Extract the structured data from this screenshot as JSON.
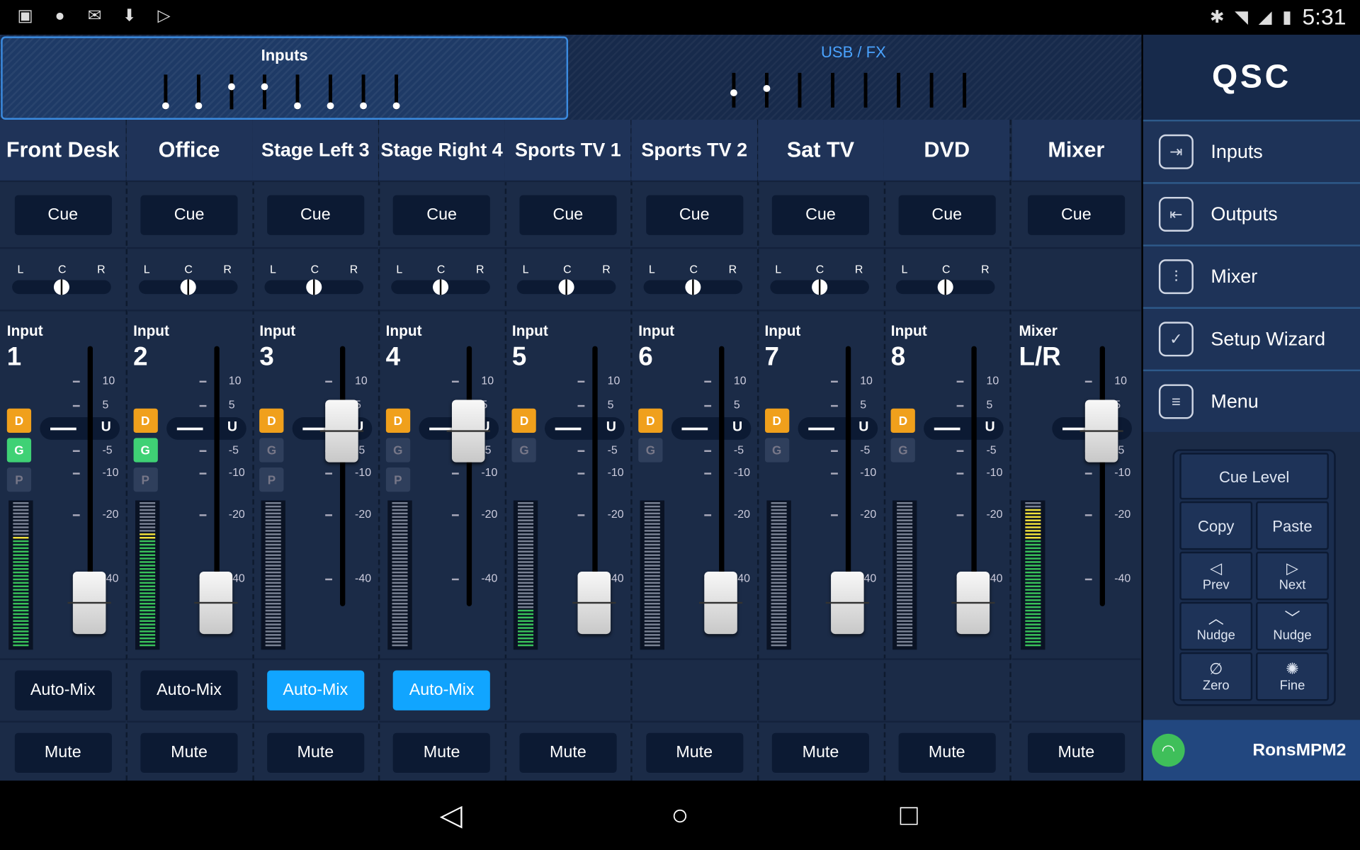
{
  "status_bar": {
    "left_icons": [
      "image-icon",
      "alert-icon",
      "mail-open-icon",
      "download-icon",
      "play-store-icon"
    ],
    "right_icons": [
      "bluetooth-icon",
      "wifi-icon",
      "signal-icon",
      "battery-charging-icon"
    ],
    "time": "5:31"
  },
  "overview": {
    "inputs_label": "Inputs",
    "usb_fx_label": "USB / FX",
    "input_levels": [
      0.95,
      0.95,
      0.3,
      0.3,
      0.95,
      0.95,
      0.95,
      0.95
    ],
    "usb_fx_levels": [
      0.55,
      0.4,
      null,
      null,
      null,
      null,
      null,
      null
    ]
  },
  "channels": [
    {
      "name": "Front Desk",
      "cue": "Cue",
      "pan": {
        "l": "L",
        "c": "C",
        "r": "R"
      },
      "src": "Input",
      "num": "1",
      "d": "D",
      "g": "G",
      "p": "P",
      "g_on": true,
      "p_on": false,
      "fader": 0.0,
      "meter_level": 0.75,
      "automix": "Auto-Mix",
      "automix_on": false,
      "mute": "Mute"
    },
    {
      "name": "Office",
      "cue": "Cue",
      "pan": {
        "l": "L",
        "c": "C",
        "r": "R"
      },
      "src": "Input",
      "num": "2",
      "d": "D",
      "g": "G",
      "p": "P",
      "g_on": true,
      "p_on": false,
      "fader": 0.0,
      "meter_level": 0.78,
      "automix": "Auto-Mix",
      "automix_on": false,
      "mute": "Mute"
    },
    {
      "name": "Stage Left 3",
      "cue": "Cue",
      "pan": {
        "l": "L",
        "c": "C",
        "r": "R"
      },
      "src": "Input",
      "num": "3",
      "d": "D",
      "g": "G",
      "p": "P",
      "g_on": false,
      "p_on": false,
      "fader": 0.66,
      "meter_level": 0,
      "automix": "Auto-Mix",
      "automix_on": true,
      "mute": "Mute"
    },
    {
      "name": "Stage Right 4",
      "cue": "Cue",
      "pan": {
        "l": "L",
        "c": "C",
        "r": "R"
      },
      "src": "Input",
      "num": "4",
      "d": "D",
      "g": "G",
      "p": "P",
      "g_on": false,
      "p_on": false,
      "fader": 0.66,
      "meter_level": 0,
      "automix": "Auto-Mix",
      "automix_on": true,
      "mute": "Mute"
    },
    {
      "name": "Sports TV 1",
      "cue": "Cue",
      "pan": {
        "l": "L",
        "c": "C",
        "r": "R"
      },
      "src": "Input",
      "num": "5",
      "d": "D",
      "g": "G",
      "p": null,
      "g_on": false,
      "p_on": false,
      "fader": 0.0,
      "meter_level": 0.25,
      "automix": null,
      "automix_on": false,
      "mute": "Mute"
    },
    {
      "name": "Sports TV 2",
      "cue": "Cue",
      "pan": {
        "l": "L",
        "c": "C",
        "r": "R"
      },
      "src": "Input",
      "num": "6",
      "d": "D",
      "g": "G",
      "p": null,
      "g_on": false,
      "p_on": false,
      "fader": 0.0,
      "meter_level": 0,
      "automix": null,
      "automix_on": false,
      "mute": "Mute"
    },
    {
      "name": "Sat TV",
      "cue": "Cue",
      "pan": {
        "l": "L",
        "c": "C",
        "r": "R"
      },
      "src": "Input",
      "num": "7",
      "d": "D",
      "g": "G",
      "p": null,
      "g_on": false,
      "p_on": false,
      "fader": 0.0,
      "meter_level": 0,
      "automix": null,
      "automix_on": false,
      "mute": "Mute"
    },
    {
      "name": "DVD",
      "cue": "Cue",
      "pan": {
        "l": "L",
        "c": "C",
        "r": "R"
      },
      "src": "Input",
      "num": "8",
      "d": "D",
      "g": "G",
      "p": null,
      "g_on": false,
      "p_on": false,
      "fader": 0.0,
      "meter_level": 0,
      "automix": null,
      "automix_on": false,
      "mute": "Mute"
    }
  ],
  "mixer_channel": {
    "name": "Mixer",
    "cue": "Cue",
    "src": "Mixer",
    "num": "L/R",
    "fader": 0.66,
    "meter_level": 0.95,
    "mute": "Mute"
  },
  "fader_scale": [
    "10",
    "5",
    "U",
    "-5",
    "-10",
    "-20",
    "-40"
  ],
  "sidebar": {
    "logo": "QSC",
    "nav": [
      {
        "label": "Inputs",
        "icon": "input-arrow-icon"
      },
      {
        "label": "Outputs",
        "icon": "output-arrow-icon"
      },
      {
        "label": "Mixer",
        "icon": "faders-icon"
      },
      {
        "label": "Setup Wizard",
        "icon": "clipboard-check-icon"
      },
      {
        "label": "Menu",
        "icon": "list-icon"
      }
    ],
    "keypad": {
      "cue_level": "Cue Level",
      "copy": "Copy",
      "paste": "Paste",
      "prev": "Prev",
      "next": "Next",
      "nudge_up": "Nudge",
      "nudge_down": "Nudge",
      "zero": "Zero",
      "fine": "Fine"
    },
    "device_name": "RonsMPM2"
  },
  "colors": {
    "accent_blue": "#11a5ff",
    "d_orange": "#f0a01c",
    "g_green": "#3fd175",
    "panel": "#1b2b47"
  }
}
